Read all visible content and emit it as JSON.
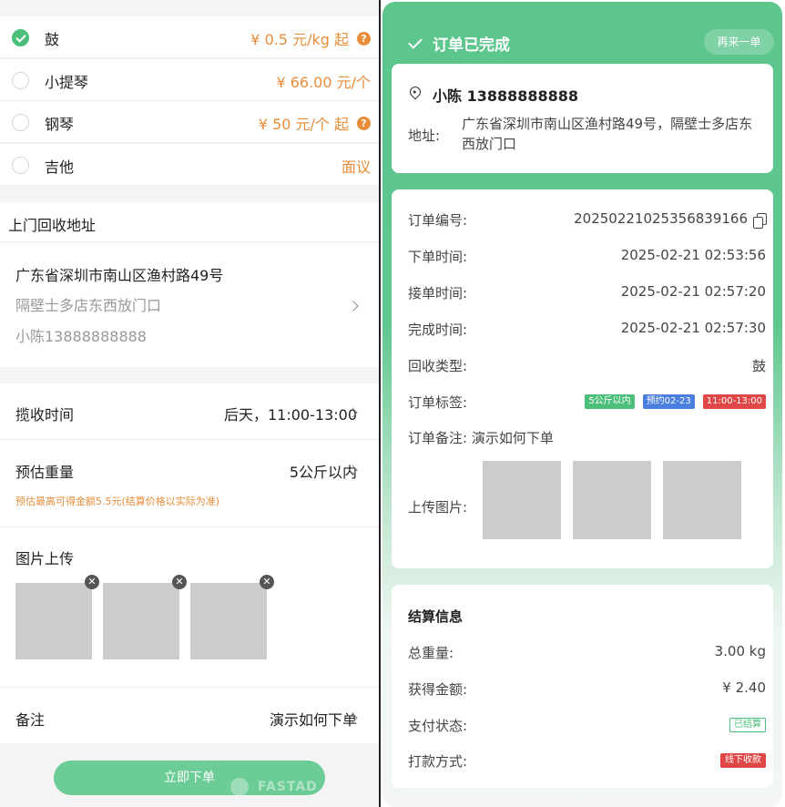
{
  "categories": [
    {
      "name": "鼓",
      "price": "¥ 0.5 元/kg 起",
      "selected": true,
      "help": true
    },
    {
      "name": "小提琴",
      "price": "¥ 66.00 元/个",
      "selected": false,
      "help": false
    },
    {
      "name": "钢琴",
      "price": "¥ 50 元/个 起",
      "selected": false,
      "help": true
    },
    {
      "name": "吉他",
      "price": "面议",
      "selected": false,
      "help": false
    }
  ],
  "address_section": {
    "title": "上门回收地址",
    "line1": "广东省深圳市南山区渔村路49号",
    "line2": "隔壁士多店东西放门口",
    "line3": "小陈13888888888"
  },
  "form": {
    "pickup_label": "揽收时间",
    "pickup_value": "后天，11:00-13:00",
    "weight_label": "预估重量",
    "weight_value": "5公斤以内",
    "weight_hint": "预估最高可得金额5.5元(结算价格以实际为准)",
    "upload_label": "图片上传",
    "remark_label": "备注",
    "remark_value": "演示如何下单"
  },
  "submit_label": "立即下单",
  "watermark": "FASTAD",
  "order_panel": {
    "status": "订单已完成",
    "again_label": "再来一单",
    "contact": "小陈  13888888888",
    "address_label": "地址:",
    "address": "广东省深圳市南山区渔村路49号，隔壁士多店东西放门口",
    "rows": [
      {
        "label": "订单编号:",
        "value": "20250221025356839166"
      },
      {
        "label": "下单时间:",
        "value": "2025-02-21 02:53:56"
      },
      {
        "label": "接单时间:",
        "value": "2025-02-21 02:57:20"
      },
      {
        "label": "完成时间:",
        "value": "2025-02-21 02:57:30"
      },
      {
        "label": "回收类型:",
        "value": "鼓"
      }
    ],
    "tags_label": "订单标签:",
    "tags": [
      {
        "text": "5公斤以内",
        "color": "#4cc07a"
      },
      {
        "text": "预约02-23",
        "color": "#4a7fe0"
      },
      {
        "text": "11:00-13:00",
        "color": "#e04848"
      }
    ],
    "remark": "订单备注:  演示如何下单",
    "pics_label": "上传图片:"
  },
  "settlement": {
    "title": "结算信息",
    "weight_label": "总重量:",
    "weight_value": "3.00 kg",
    "amount_label": "获得金额:",
    "amount_value": "¥ 2.40",
    "pay_status_label": "支付状态:",
    "pay_status_value": "已结算",
    "pay_method_label": "打款方式:",
    "pay_method_value": "线下收款"
  }
}
